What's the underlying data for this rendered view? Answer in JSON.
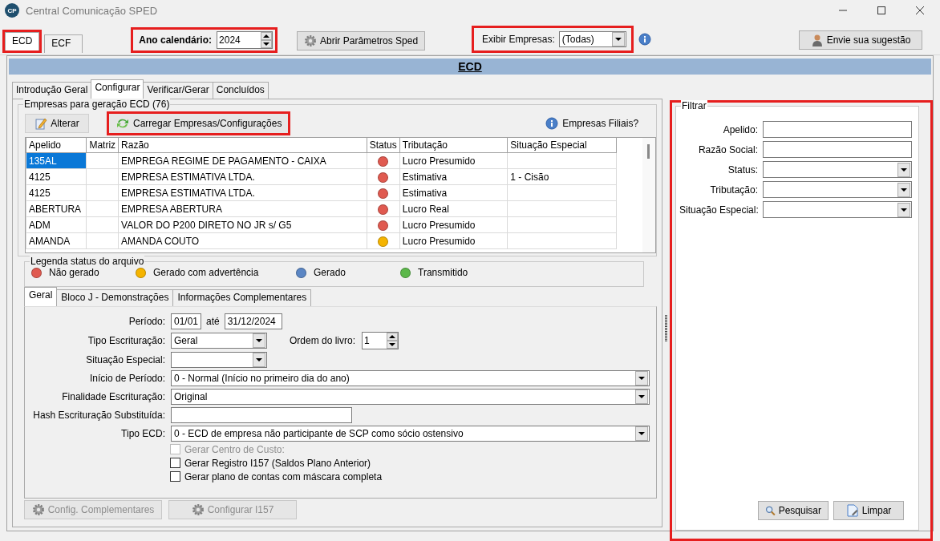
{
  "window": {
    "app_icon_text": "CP",
    "title": "Central Comunicação SPED"
  },
  "top_tabs": [
    {
      "label": "ECD",
      "selected": true,
      "highlighted": true
    },
    {
      "label": "ECF",
      "selected": false,
      "highlighted": false
    }
  ],
  "year": {
    "label": "Ano calendário:",
    "value": "2024",
    "highlighted": true
  },
  "open_params_button": "Abrir Parâmetros Sped",
  "show_companies": {
    "label": "Exibir Empresas:",
    "value": "(Todas)",
    "highlighted": true
  },
  "suggestion_button": "Envie sua sugestão",
  "header": "ECD",
  "section_tabs": [
    {
      "label": "Introdução Geral",
      "selected": false
    },
    {
      "label": "Configurar",
      "selected": true
    },
    {
      "label": "Verificar/Gerar",
      "selected": false
    },
    {
      "label": "Concluídos",
      "selected": false
    }
  ],
  "companies": {
    "title": "Empresas para geração ECD (76)",
    "buttons": [
      {
        "label": "Alterar",
        "kind": "edit",
        "highlighted": false
      },
      {
        "label": "Carregar Empresas/Configurações",
        "kind": "reload",
        "highlighted": true
      }
    ],
    "branches_link": "Empresas Filiais?",
    "columns": [
      "Apelido",
      "Matriz",
      "Razão",
      "Status",
      "Tributação",
      "Situação Especial"
    ],
    "rows": [
      {
        "nickname": "135AL",
        "company_name": "EMPREGA REGIME DE PAGAMENTO - CAIXA",
        "color": "#e05a50",
        "taxation": "Lucro Presumido",
        "selected": true
      },
      {
        "nickname": "4125",
        "company_name": "EMPRESA ESTIMATIVA LTDA.",
        "color": "#e05a50",
        "taxation": "Estimativa",
        "special_situation": "1 - Cisão",
        "selected": false
      },
      {
        "nickname": "4125",
        "company_name": "EMPRESA ESTIMATIVA LTDA.",
        "color": "#e05a50",
        "taxation": "Estimativa",
        "selected": false
      },
      {
        "nickname": "ABERTURA",
        "company_name": "EMPRESA ABERTURA",
        "color": "#e05a50",
        "taxation": "Lucro Real",
        "selected": false
      },
      {
        "nickname": "ADM",
        "company_name": "VALOR DO P200 DIRETO NO JR s/ G5",
        "color": "#e05a50",
        "taxation": "Lucro Presumido",
        "selected": false
      },
      {
        "nickname": "AMANDA",
        "company_name": "AMANDA COUTO",
        "color": "#f5b400",
        "taxation": "Lucro Presumido",
        "selected": false
      }
    ]
  },
  "legend": {
    "title": "Legenda status do arquivo",
    "items": [
      {
        "label": "Não gerado",
        "color": "#e05a50"
      },
      {
        "label": "Gerado com advertência",
        "color": "#f5b400"
      },
      {
        "label": "Gerado",
        "color": "#5b86c4"
      },
      {
        "label": "Transmitido",
        "color": "#5cb84a"
      }
    ]
  },
  "form_tabs": [
    {
      "label": "Geral",
      "selected": true
    },
    {
      "label": "Bloco J - Demonstrações",
      "selected": false
    },
    {
      "label": "Informações Complementares",
      "selected": false
    }
  ],
  "form_fields": [
    {
      "kind": "date_range",
      "label": "Período:",
      "start": "01/01",
      "separator": "até",
      "end": "31/12/2024"
    },
    {
      "kind": "short_combo",
      "label": "Tipo Escrituração:",
      "value": "Geral",
      "extra_label": "Ordem do livro:",
      "extra_value": "1"
    },
    {
      "kind": "short_combo",
      "label": "Situação Especial:"
    },
    {
      "kind": "combo",
      "label": "Início de Período:",
      "value": "0 - Normal (Início no primeiro dia do ano)"
    },
    {
      "kind": "combo",
      "label": "Finalidade Escrituração:",
      "value": "Original"
    },
    {
      "kind": "text",
      "label": "Hash Escrituração Substituída:"
    },
    {
      "kind": "combo",
      "label": "Tipo ECD:",
      "value": "0 - ECD de empresa não participante de SCP como sócio ostensivo"
    }
  ],
  "checkboxes": [
    {
      "label": "Gerar Centro de Custo:",
      "checked": false,
      "disabled": true
    },
    {
      "label": "Gerar Registro I157 (Saldos Plano Anterior)",
      "checked": false,
      "disabled": false
    },
    {
      "label": "Gerar plano de contas com máscara completa",
      "checked": false,
      "disabled": false
    }
  ],
  "bottom_buttons": [
    {
      "label": "Config. Complementares",
      "disabled": true
    },
    {
      "label": "Configurar I157",
      "disabled": true
    }
  ],
  "filter": {
    "title": "Filtrar",
    "highlighted": true,
    "fields": [
      {
        "kind": "text",
        "label": "Apelido:"
      },
      {
        "kind": "text",
        "label": "Razão Social:"
      },
      {
        "kind": "combo",
        "label": "Status:"
      },
      {
        "kind": "combo",
        "label": "Tributação:"
      },
      {
        "kind": "combo",
        "label": "Situação Especial:"
      }
    ],
    "buttons": [
      {
        "label": "Pesquisar",
        "kind": "search"
      },
      {
        "label": "Limpar",
        "kind": "clear"
      }
    ]
  }
}
